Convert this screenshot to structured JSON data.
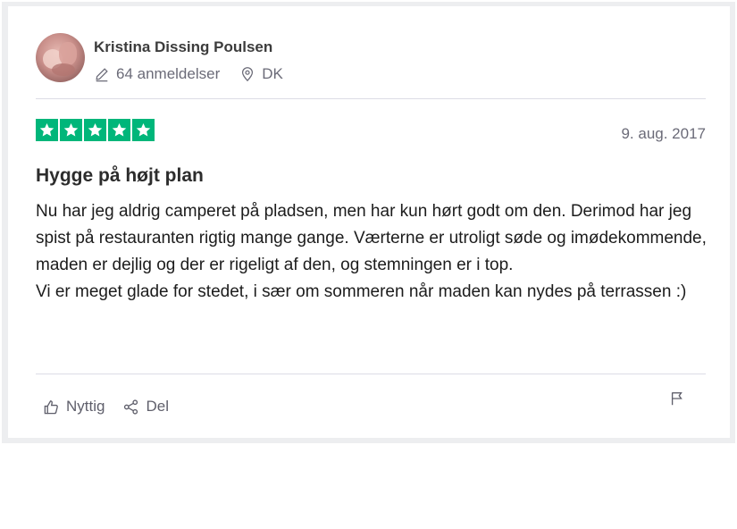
{
  "reviewer": {
    "name": "Kristina Dissing Poulsen",
    "review_count": "64 anmeldelser",
    "country": "DK"
  },
  "review": {
    "rating": 5,
    "rating_max": 5,
    "date": "9. aug. 2017",
    "title": "Hygge på højt plan",
    "paragraphs": [
      "Nu har jeg aldrig camperet på pladsen, men har kun hørt godt om den. Derimod har jeg spist på restauranten rigtig mange gange. Værterne er utroligt søde og imødekommende, maden er dejlig og der er rigeligt af den, og stemningen er i top.",
      "Vi er meget glade for stedet, i sær om sommeren når maden kan nydes på terrassen :)"
    ]
  },
  "actions": {
    "useful_label": "Nyttig",
    "share_label": "Del"
  },
  "icons": {
    "review_count": "pencil-icon",
    "country": "location-pin-icon",
    "useful": "thumbs-up-icon",
    "share": "share-icon",
    "report": "flag-icon",
    "rating": "star-icon"
  },
  "colors": {
    "star_green": "#00b67a",
    "muted_text": "#6b6b78",
    "divider": "#dcdce6"
  }
}
